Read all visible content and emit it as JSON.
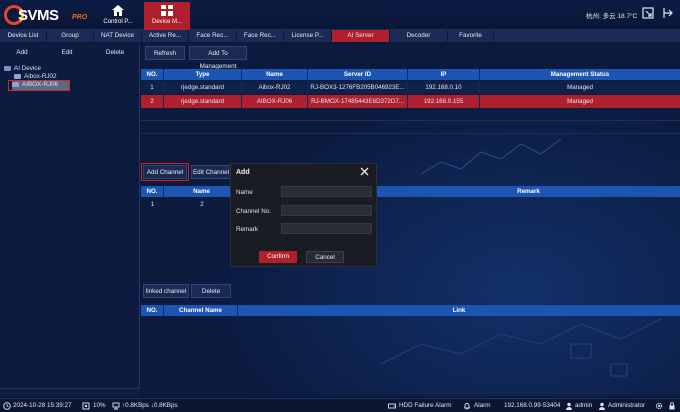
{
  "app": {
    "logo_text": "SVMS",
    "logo_sub": "PRO"
  },
  "header": {
    "tabs": [
      {
        "label": "Control P..."
      },
      {
        "label": "Device M..."
      }
    ],
    "weather": "杭州: 多云  18.7°C"
  },
  "subtabs": [
    "Device List",
    "Group",
    "NAT Device",
    "Active Re...",
    "Face Rec...",
    "Face Rec...",
    "License P...",
    "AI Server",
    "Decoder",
    "Favorite"
  ],
  "left_toolbar": {
    "add": "Add",
    "edit": "Edit",
    "delete": "Delete"
  },
  "tree": {
    "root": "AI Device",
    "items": [
      "Aibox-RJ02",
      "AIBOX-RJ06"
    ]
  },
  "server_toolbar": {
    "refresh": "Refresh",
    "add_to_management": "Add To Management"
  },
  "server_table": {
    "headers": [
      "NO.",
      "Type",
      "Name",
      "Server ID",
      "IP",
      "Management Status"
    ],
    "rows": [
      [
        "1",
        "rjedge.standard",
        "Aibox-RJ02",
        "RJ-BOX3-1276FB205B046923E...",
        "192.168.0.10",
        "Managed"
      ],
      [
        "2",
        "rjedge.standard",
        "AIBOX-RJ06",
        "RJ-BMOX-17485443E6D372D7...",
        "192.168.0.155",
        "Managed"
      ]
    ]
  },
  "channel_toolbar": {
    "add_channel": "Add Channel",
    "edit_channel": "Edit Channel"
  },
  "channel_table": {
    "headers": [
      "NO.",
      "Name",
      "Remark"
    ],
    "rows": [
      [
        "1",
        "2",
        ""
      ]
    ]
  },
  "linked_toolbar": {
    "linked_channel": "linked channel",
    "delete": "Delete"
  },
  "linked_table": {
    "headers": [
      "NO.",
      "Channel Name",
      "Link"
    ]
  },
  "dialog": {
    "title": "Add",
    "fields": [
      {
        "label": "Name",
        "value": ""
      },
      {
        "label": "Channel No.",
        "value": ""
      },
      {
        "label": "Remark",
        "value": ""
      }
    ],
    "confirm": "Confirm",
    "cancel": "Cancel"
  },
  "status": {
    "datetime": "2024-10-28 15:39:27",
    "cpu": "10%",
    "net": "↑0.8KBps ↓0.8KBps",
    "hdd": "HDD Failure Alarm",
    "alarm": "Alarm",
    "server": "192.168.0.99-53404",
    "user": "admin",
    "role": "Administrator"
  },
  "colors": {
    "accent_red": "#b0202c",
    "header_blue": "#1d55b2",
    "background": "#0c1a3a"
  }
}
